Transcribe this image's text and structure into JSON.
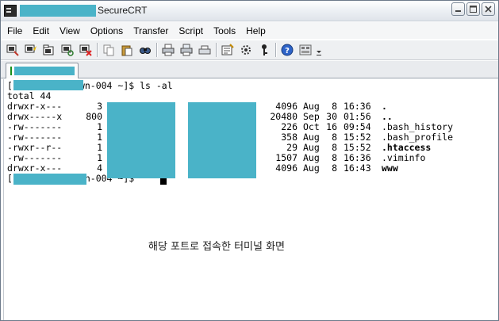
{
  "window": {
    "title": "SecureCRT",
    "controls": [
      "minimize",
      "maximize",
      "close"
    ]
  },
  "menu": [
    "File",
    "Edit",
    "View",
    "Options",
    "Transfer",
    "Script",
    "Tools",
    "Help"
  ],
  "toolbar_icons": [
    "connect-icon",
    "quick-connect-icon",
    "connect-in-tab-icon",
    "reconnect-icon",
    "disconnect-icon",
    "copy-icon",
    "paste-icon",
    "find-icon",
    "print-icon",
    "print-screen-icon",
    "print-selection-icon",
    "session-options-icon",
    "global-options-icon",
    "keymap-icon",
    "help-icon",
    "customize-icon",
    "overflow-icon"
  ],
  "terminal": {
    "prompt_tail": "wn-004 ~]$ ",
    "command": "ls -al",
    "total_line": "total 44",
    "rows": [
      {
        "perm": "drwxr-x---",
        "links": "3",
        "size": "4096",
        "month": "Aug",
        "day": "8",
        "time": "16:36",
        "name": ".",
        "bold": true
      },
      {
        "perm": "drwx-----x",
        "links": "800",
        "size": "20480",
        "month": "Sep",
        "day": "30",
        "time": "01:56",
        "name": "..",
        "bold": true
      },
      {
        "perm": "-rw-------",
        "links": "1",
        "size": "226",
        "month": "Oct",
        "day": "16",
        "time": "09:54",
        "name": ".bash_history",
        "bold": false
      },
      {
        "perm": "-rw-------",
        "links": "1",
        "size": "358",
        "month": "Aug",
        "day": "8",
        "time": "15:52",
        "name": ".bash_profile",
        "bold": false
      },
      {
        "perm": "-rwxr--r--",
        "links": "1",
        "size": "29",
        "month": "Aug",
        "day": "8",
        "time": "15:52",
        "name": ".htaccess",
        "bold": true
      },
      {
        "perm": "-rw-------",
        "links": "1",
        "size": "1507",
        "month": "Aug",
        "day": "8",
        "time": "16:36",
        "name": ".viminfo",
        "bold": false
      },
      {
        "perm": "drwxr-x---",
        "links": "4",
        "size": "4096",
        "month": "Aug",
        "day": "8",
        "time": "16:43",
        "name": "www",
        "bold": true
      }
    ]
  },
  "caption": "해당 포트로 접속한 터미널 화면",
  "colors": {
    "redaction": "#4ab3c8",
    "terminal_bg": "#ffffff",
    "terminal_fg": "#000000"
  }
}
